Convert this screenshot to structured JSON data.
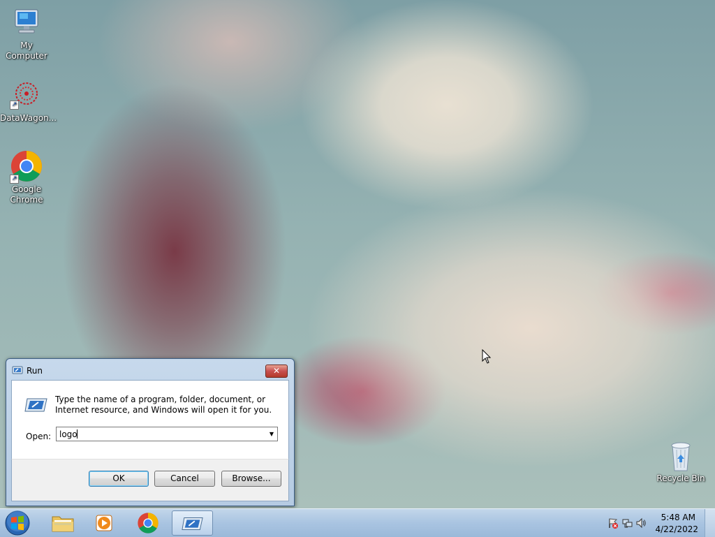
{
  "desktop": {
    "icons": [
      {
        "label": "My Computer",
        "icon": "computer-icon"
      },
      {
        "label": "DataWagon...",
        "icon": "datawagon-icon"
      },
      {
        "label": "Google Chrome",
        "icon": "chrome-icon"
      },
      {
        "label": "Recycle Bin",
        "icon": "recycle-bin-icon"
      }
    ]
  },
  "run_dialog": {
    "title": "Run",
    "close_glyph": "✕",
    "description": "Type the name of a program, folder, document, or Internet resource, and Windows will open it for you.",
    "open_label": "Open:",
    "open_value": "logo",
    "dropdown_glyph": "▼",
    "ok_label": "OK",
    "cancel_label": "Cancel",
    "browse_label": "Browse..."
  },
  "taskbar": {
    "pinned": [
      {
        "name": "Windows Explorer",
        "icon": "folder-icon"
      },
      {
        "name": "Windows Media Player",
        "icon": "media-player-icon"
      },
      {
        "name": "Google Chrome",
        "icon": "chrome-icon"
      },
      {
        "name": "Run",
        "icon": "run-icon"
      }
    ],
    "clock": {
      "time": "5:48 AM",
      "date": "4/22/2022"
    }
  },
  "colors": {
    "taskbar": "#a9c4e1",
    "dialog_frame": "#b5cbe3",
    "close_button": "#c75050"
  }
}
